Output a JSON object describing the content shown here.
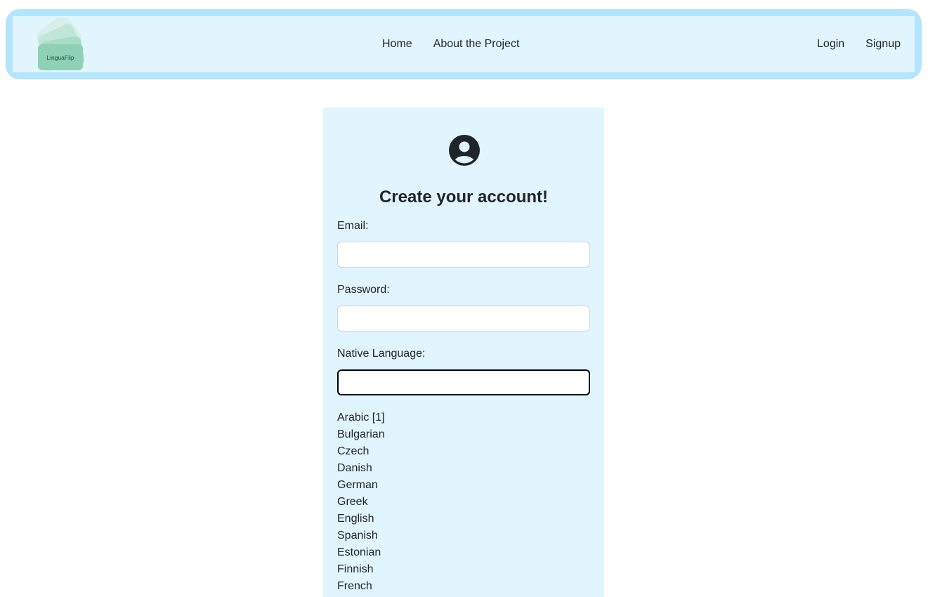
{
  "navbar": {
    "logo_text": "LinguaFlip",
    "links": [
      {
        "label": "Home"
      },
      {
        "label": "About the Project"
      }
    ],
    "auth": {
      "login": "Login",
      "signup": "Signup"
    }
  },
  "form": {
    "title": "Create your account!",
    "email_label": "Email:",
    "email_value": "",
    "password_label": "Password:",
    "password_value": "",
    "native_language_label": "Native Language:",
    "native_language_value": "",
    "languages": [
      "Arabic [1]",
      "Bulgarian",
      "Czech",
      "Danish",
      "German",
      "Greek",
      "English",
      "Spanish",
      "Estonian",
      "Finnish",
      "French"
    ]
  },
  "colors": {
    "navbar_outer": "#b3e5fc",
    "navbar_inner": "#e1f5fe",
    "card": "#e1f5fe",
    "logo_green": "#8ed1b5"
  },
  "icons": {
    "user": "user-circle-icon"
  }
}
